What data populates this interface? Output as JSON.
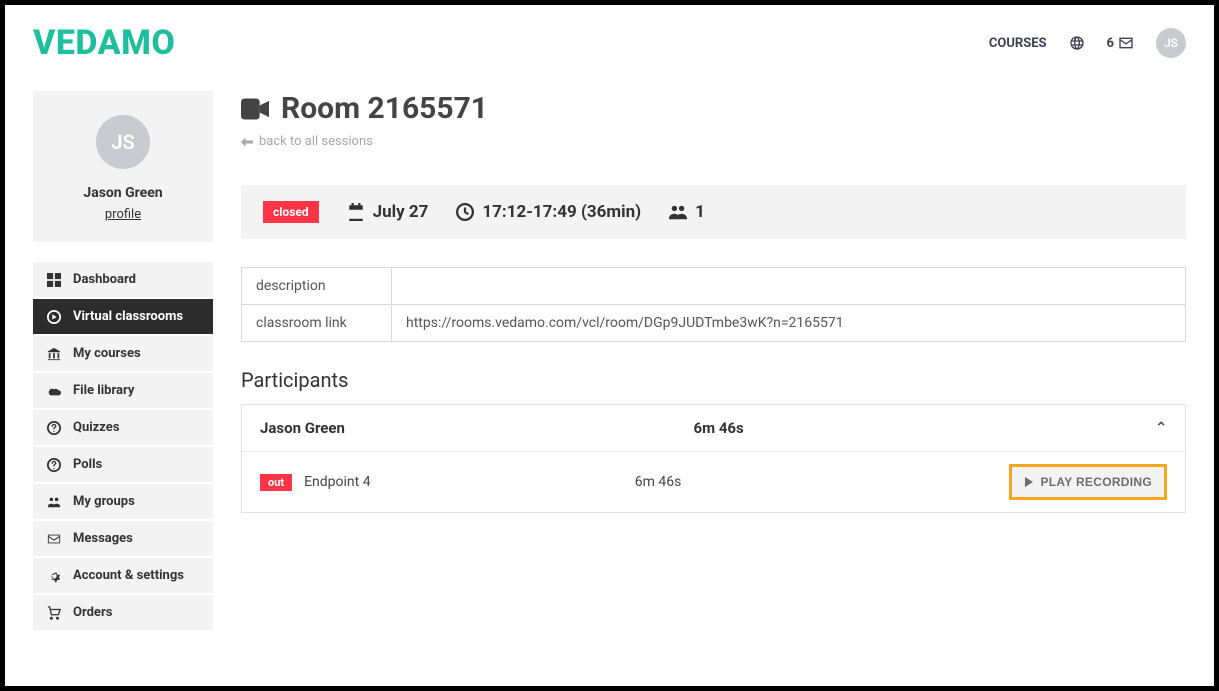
{
  "brand": "VEDAMO",
  "header": {
    "courses_label": "COURSES",
    "notif_count": "6",
    "avatar_initials": "JS"
  },
  "profile": {
    "avatar_initials": "JS",
    "name": "Jason Green",
    "profile_link": "profile"
  },
  "nav": {
    "dashboard": "Dashboard",
    "virtual_classrooms": "Virtual classrooms",
    "my_courses": "My courses",
    "file_library": "File library",
    "quizzes": "Quizzes",
    "polls": "Polls",
    "my_groups": "My groups",
    "messages": "Messages",
    "account_settings": "Account & settings",
    "orders": "Orders"
  },
  "page": {
    "title": "Room 2165571",
    "back_label": "back to all sessions"
  },
  "info": {
    "status": "closed",
    "date": "July 27",
    "time": "17:12-17:49 (36min)",
    "participants": "1"
  },
  "details": {
    "description_label": "description",
    "description_value": "",
    "link_label": "classroom link",
    "link_value": "https://rooms.vedamo.com/vcl/room/DGp9JUDTmbe3wK?n=2165571"
  },
  "participants_section": {
    "title": "Participants",
    "name": "Jason Green",
    "duration": "6m 46s",
    "row": {
      "out_badge": "out",
      "endpoint": "Endpoint 4",
      "duration": "6m 46s",
      "play_label": "PLAY RECORDING"
    }
  }
}
